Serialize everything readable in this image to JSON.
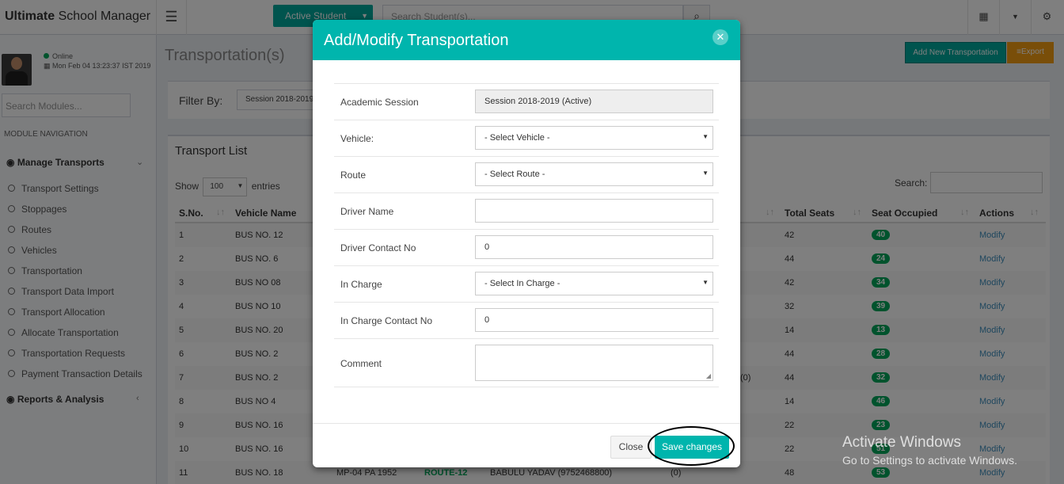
{
  "app": {
    "brand_bold": "Ultimate",
    "brand_rest": " School Manager"
  },
  "topbar": {
    "menu_icon": "hamburger-icon",
    "active_student_label": "Active Student",
    "search_placeholder": "Search Student(s)...",
    "search_icon": "search-icon",
    "right_icons": [
      "grid-icon",
      "caret-down-icon",
      "gears-icon"
    ]
  },
  "user": {
    "status": "Online",
    "datetime": "Mon Feb 04 13:23:37 IST 2019"
  },
  "sidebar": {
    "search_placeholder": "Search Modules...",
    "nav_heading": "MODULE NAVIGATION",
    "group_1": "Manage Transports",
    "items": [
      "Transport Settings",
      "Stoppages",
      "Routes",
      "Vehicles",
      "Transportation",
      "Transport Data Import",
      "Transport Allocation",
      "Allocate Transportation",
      "Transportation Requests",
      "Payment Transaction Details"
    ],
    "group_2": "Reports & Analysis"
  },
  "page": {
    "title": "Transportation(s)",
    "add_button": "Add New Transportation",
    "export_button": "Export",
    "filter_label": "Filter By:",
    "filter_value": "Session 2018-2019",
    "list_title": "Transport List",
    "show": "Show",
    "entries_value": "100",
    "entries": "entries",
    "search_label": "Search:",
    "columns": [
      "S.No.",
      "Vehicle Name",
      "Total Seats",
      "Seat Occupied",
      "Actions"
    ],
    "rows": [
      {
        "sno": "1",
        "vehicle": "BUS NO. 12",
        "seats": "42",
        "occupied": "40",
        "action": "Modify"
      },
      {
        "sno": "2",
        "vehicle": "BUS NO. 6",
        "seats": "44",
        "occupied": "24",
        "action": "Modify"
      },
      {
        "sno": "3",
        "vehicle": "BUS NO 08",
        "seats": "42",
        "occupied": "34",
        "action": "Modify"
      },
      {
        "sno": "4",
        "vehicle": "BUS NO 10",
        "seats": "32",
        "occupied": "39",
        "action": "Modify"
      },
      {
        "sno": "5",
        "vehicle": "BUS NO. 20",
        "seats": "14",
        "occupied": "13",
        "action": "Modify"
      },
      {
        "sno": "6",
        "vehicle": "BUS NO. 2",
        "seats": "44",
        "occupied": "28",
        "action": "Modify"
      },
      {
        "sno": "7",
        "vehicle": "BUS NO. 2",
        "seats": "44",
        "occupied": "32",
        "action": "Modify",
        "extra": "(0)"
      },
      {
        "sno": "8",
        "vehicle": "BUS NO 4",
        "seats": "14",
        "occupied": "46",
        "action": "Modify"
      },
      {
        "sno": "9",
        "vehicle": "BUS NO. 16",
        "seats": "22",
        "occupied": "23",
        "action": "Modify"
      },
      {
        "sno": "10",
        "vehicle": "BUS NO. 16",
        "seats": "22",
        "occupied": "51",
        "action": "Modify"
      },
      {
        "sno": "11",
        "vehicle": "BUS NO. 18",
        "seats": "48",
        "occupied": "53",
        "action": "Modify",
        "reg": "MP-04 PA 1952",
        "route": "ROUTE-12",
        "driver": "BABULU YADAV (9752468800)",
        "extra": "(0)"
      }
    ]
  },
  "modal": {
    "title": "Add/Modify Transportation",
    "close_icon": "close-icon",
    "fields": {
      "session_label": "Academic Session",
      "session_value": "Session 2018-2019 (Active)",
      "vehicle_label": "Vehicle:",
      "vehicle_value": "- Select Vehicle -",
      "route_label": "Route",
      "route_value": "- Select Route -",
      "driver_label": "Driver Name",
      "driver_value": "",
      "driver_contact_label": "Driver Contact No",
      "driver_contact_value": "0",
      "incharge_label": "In Charge",
      "incharge_value": "- Select In Charge -",
      "incharge_contact_label": "In Charge Contact No",
      "incharge_contact_value": "0",
      "comment_label": "Comment",
      "comment_value": ""
    },
    "close_button": "Close",
    "save_button": "Save changes"
  },
  "watermark": {
    "line1": "Activate Windows",
    "line2": "Go to Settings to activate Windows."
  },
  "colors": {
    "accent": "#00b5ad",
    "badge": "#00a65a",
    "export": "#f39c12"
  }
}
